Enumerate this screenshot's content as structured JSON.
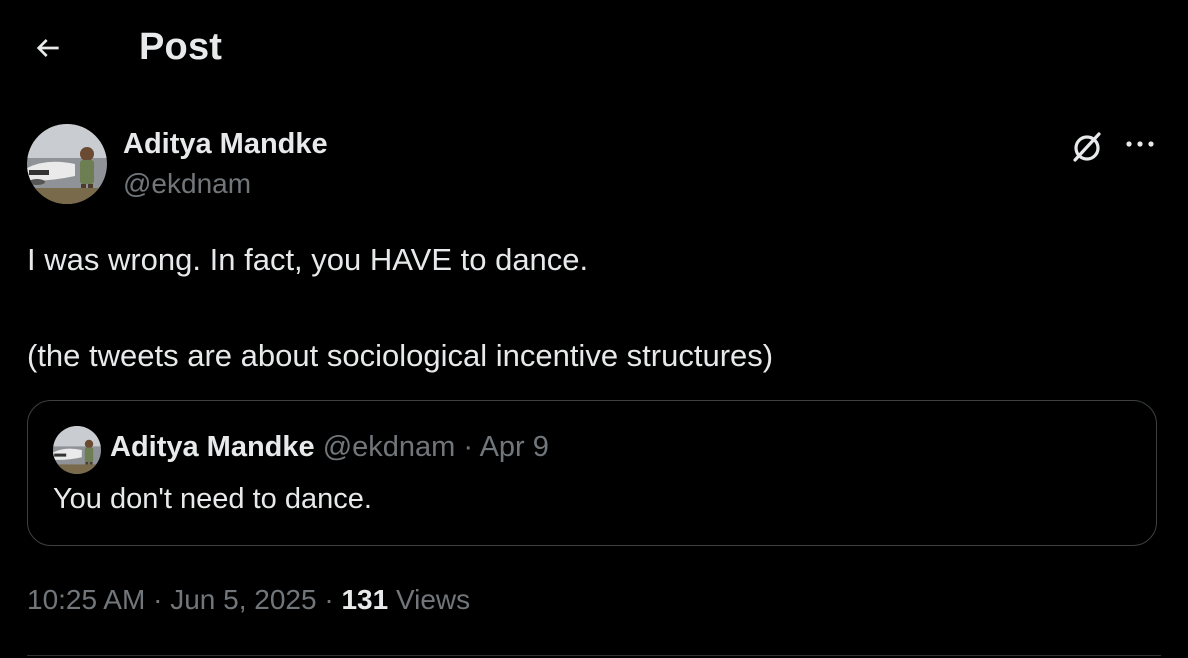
{
  "header": {
    "title": "Post",
    "back_icon": "arrow-left-icon"
  },
  "tweet": {
    "author_name": "Aditya Mandke",
    "author_handle": "@ekdnam",
    "text_line_1": "I was wrong. In fact, you HAVE to dance.",
    "text_line_2": "(the tweets are about sociological incentive structures)",
    "actions": {
      "grok_icon": "grok-icon",
      "more_icon": "more-horizontal-icon"
    }
  },
  "quoted_tweet": {
    "author_name": "Aditya Mandke",
    "author_handle": "@ekdnam",
    "separator": "·",
    "date": "Apr 9",
    "text": "You don't need to dance."
  },
  "meta": {
    "time": "10:25 AM",
    "separator": "·",
    "date": "Jun 5, 2025",
    "views_count": "131",
    "views_label": "Views"
  },
  "colors": {
    "background": "#000000",
    "primary_text": "#e7e9ea",
    "secondary_text": "#71767b",
    "border": "#3c4043"
  }
}
